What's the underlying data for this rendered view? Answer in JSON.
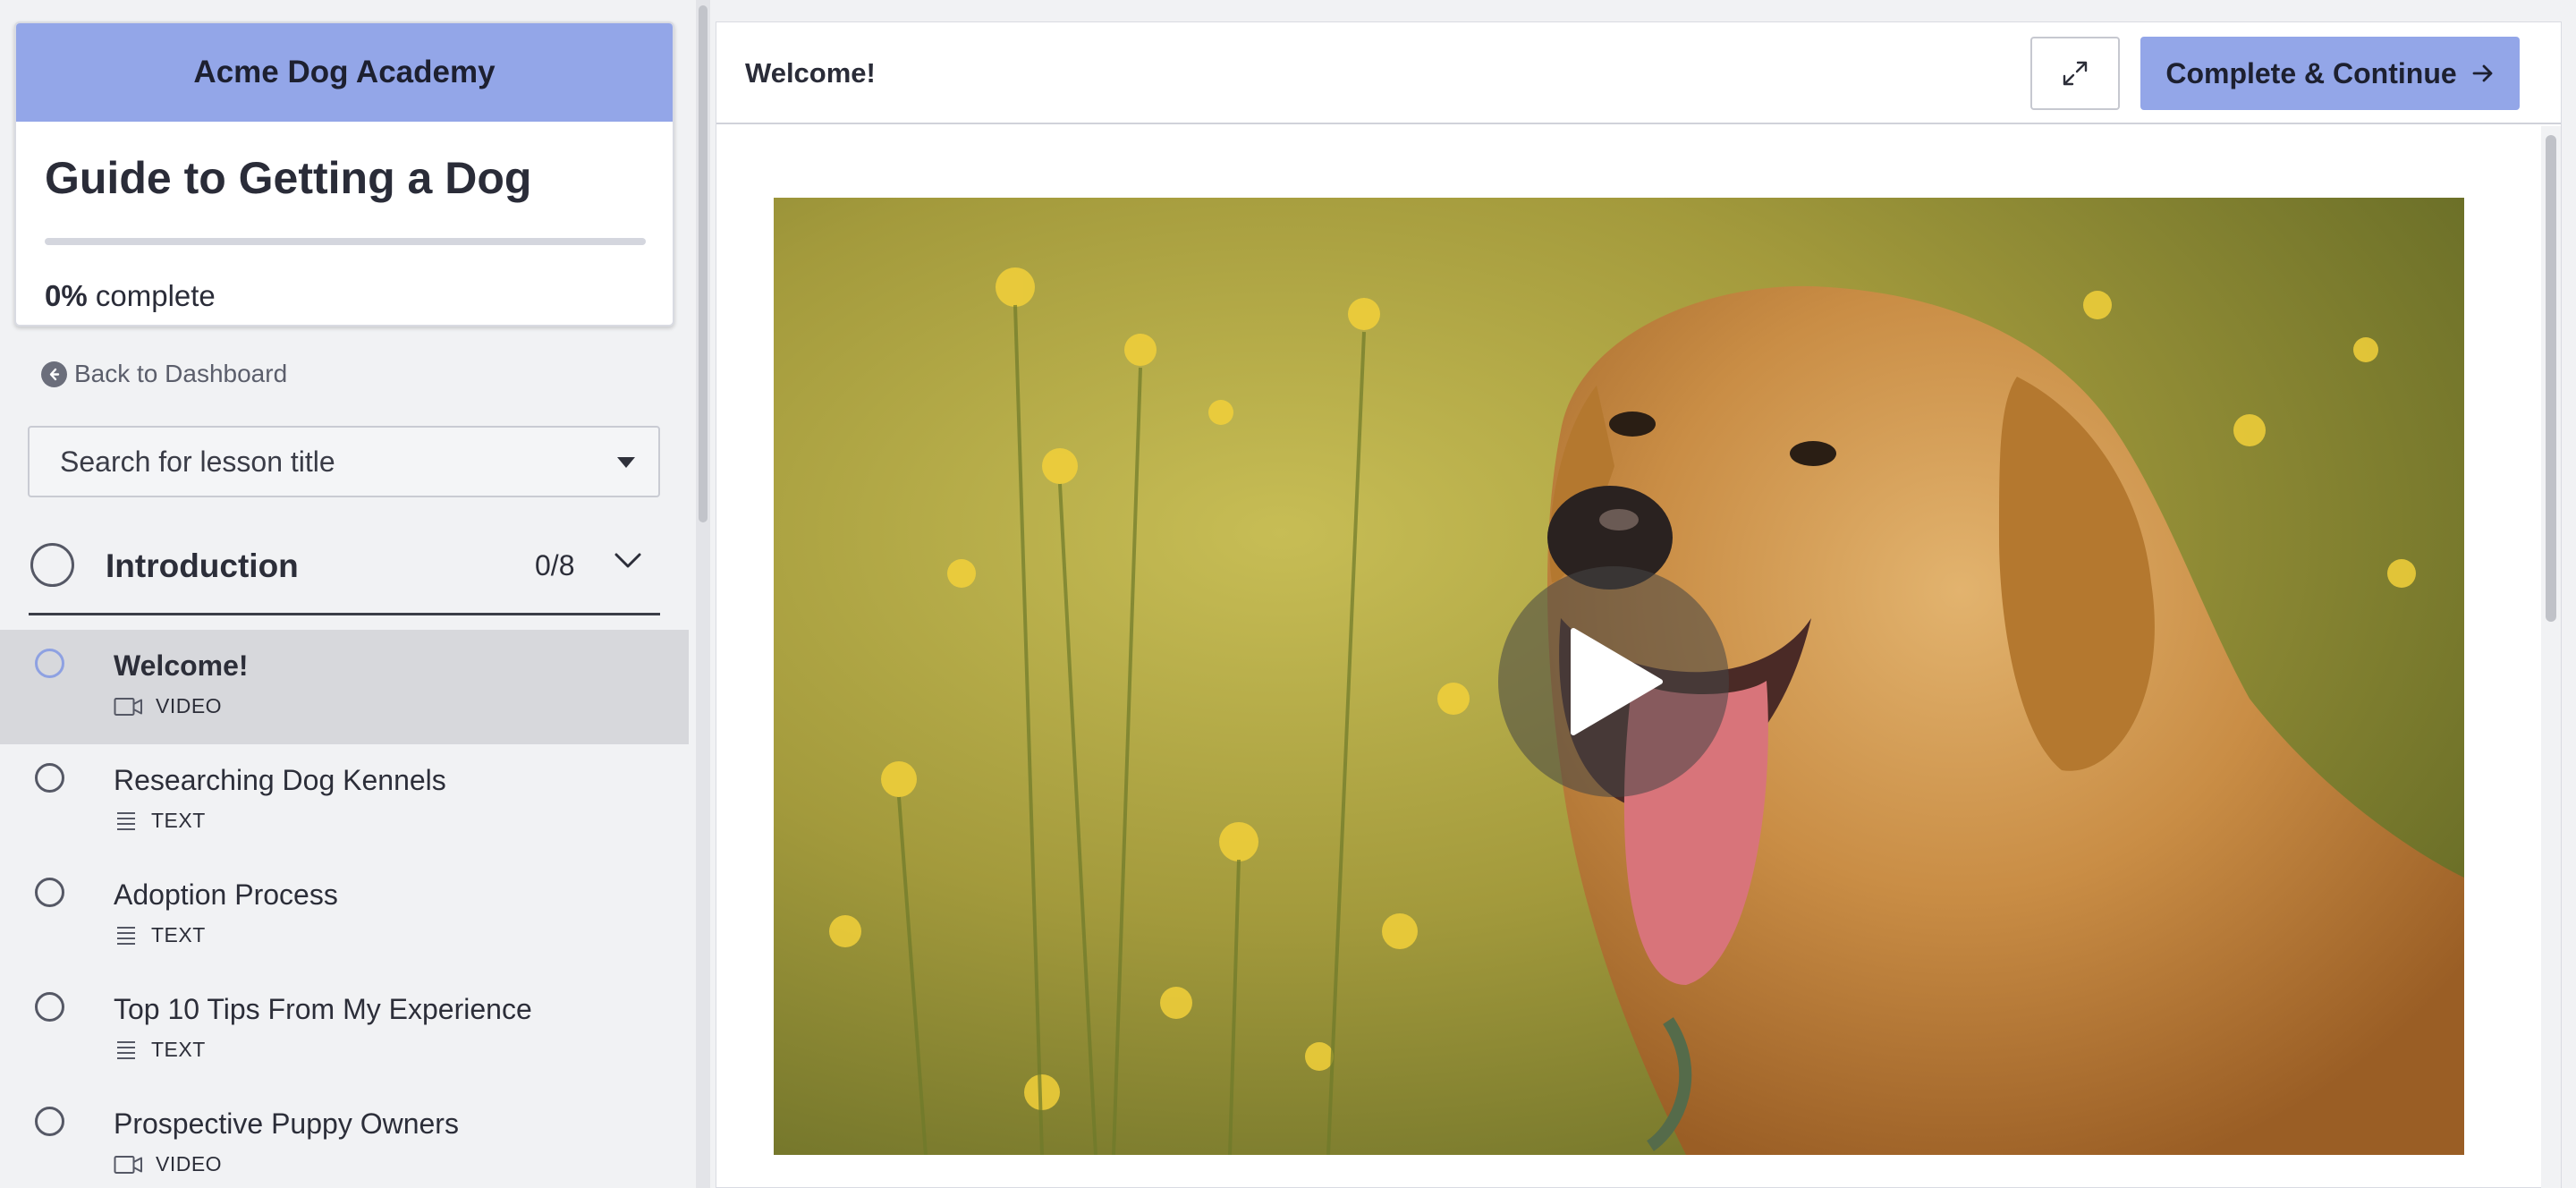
{
  "sidebar": {
    "school_name": "Acme Dog Academy",
    "course_title": "Guide to Getting a Dog",
    "progress": {
      "percent_label": "0%",
      "suffix": "complete",
      "fraction": 0
    },
    "back_label": "Back to Dashboard",
    "search_placeholder": "Search for lesson title",
    "chapter": {
      "title": "Introduction",
      "count": "0/8"
    },
    "lessons": [
      {
        "title": "Welcome!",
        "type": "VIDEO",
        "icon": "video-icon",
        "active": true
      },
      {
        "title": "Researching Dog Kennels",
        "type": "TEXT",
        "icon": "text-icon"
      },
      {
        "title": "Adoption Process",
        "type": "TEXT",
        "icon": "text-icon"
      },
      {
        "title": "Top 10 Tips From My Experience",
        "type": "TEXT",
        "icon": "text-icon"
      },
      {
        "title": "Prospective Puppy Owners",
        "type": "VIDEO",
        "icon": "video-icon"
      }
    ]
  },
  "header": {
    "lesson_title": "Welcome!",
    "expand_icon": "expand-icon",
    "continue_label": "Complete & Continue",
    "continue_icon": "arrow-right-icon"
  },
  "video": {
    "thumbnail": "golden retriever in yellow flower field",
    "play_icon": "play-icon"
  },
  "colors": {
    "accent": "#93a6e8",
    "active_row": "#d7d8dc",
    "text": "#2b2d38"
  }
}
